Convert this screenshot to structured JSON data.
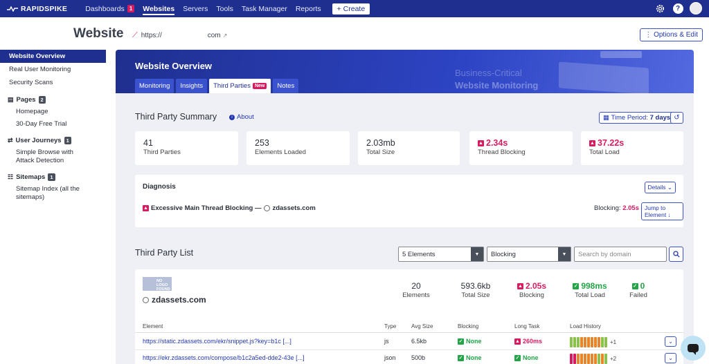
{
  "nav": {
    "logo": "RAPIDSPIKE",
    "items": [
      {
        "label": "Dashboards",
        "badge": "1"
      },
      {
        "label": "Websites"
      },
      {
        "label": "Servers"
      },
      {
        "label": "Tools"
      },
      {
        "label": "Task Manager"
      },
      {
        "label": "Reports"
      }
    ],
    "create": "+ Create",
    "help": "?"
  },
  "header": {
    "title": "Website",
    "url_prefix": "https://",
    "url_suffix": "com",
    "options": "⋮ Options & Edit"
  },
  "sidebar": {
    "overview": "Website Overview",
    "rum": "Real User Monitoring",
    "security": "Security Scans",
    "pages": {
      "label": "Pages",
      "count": "2",
      "items": [
        "Homepage",
        "30-Day Free Trial"
      ]
    },
    "journeys": {
      "label": "User Journeys",
      "count": "1",
      "items": [
        "Simple Browse with Attack Detection"
      ]
    },
    "sitemaps": {
      "label": "Sitemaps",
      "count": "1",
      "items": [
        "Sitemap Index (all the sitemaps)"
      ]
    }
  },
  "banner": {
    "title": "Website Overview",
    "mark1": "Business-Critical",
    "mark2": "Website Monitoring",
    "tabs": [
      "Monitoring",
      "Insights",
      "Third Parties",
      "Notes"
    ],
    "new_badge": "New"
  },
  "summary": {
    "title": "Third Party Summary",
    "about": "About",
    "time_label": "Time Period:",
    "time_value": "7 days",
    "stats": [
      {
        "value": "41",
        "label": "Third Parties"
      },
      {
        "value": "253",
        "label": "Elements Loaded"
      },
      {
        "value": "2.03mb",
        "label": "Total Size"
      },
      {
        "value": "2.34s",
        "label": "Thread Blocking"
      },
      {
        "value": "37.22s",
        "label": "Total Load"
      }
    ]
  },
  "diagnosis": {
    "title": "Diagnosis",
    "details": "Details ⌄",
    "issue": "Excessive Main Thread Blocking —",
    "domain": "zdassets.com",
    "blocking_label": "Blocking:",
    "blocking_value": "2.05s",
    "jump": "Jump to Element ↓"
  },
  "list": {
    "title": "Third Party List",
    "filter1": "5 Elements",
    "filter2": "Blocking",
    "search_placeholder": "Search by domain",
    "no_logo": "NO LOGO FOUND",
    "vendor": "zdassets.com",
    "vendor_stats": [
      {
        "value": "20",
        "label": "Elements"
      },
      {
        "value": "593.6kb",
        "label": "Total Size"
      },
      {
        "value": "2.05s",
        "label": "Blocking"
      },
      {
        "value": "998ms",
        "label": "Total Load"
      },
      {
        "value": "0",
        "label": "Failed"
      }
    ],
    "columns": [
      "Element",
      "Type",
      "Avg Size",
      "Blocking",
      "Long Task",
      "Load History"
    ],
    "rows": [
      {
        "element": "https://static.zdassets.com/ekr/snippet.js?key=b1c [...]",
        "type": "js",
        "size": "6.5kb",
        "blocking": "None",
        "long_task": "260ms",
        "more": "+1"
      },
      {
        "element": "https://ekr.zdassets.com/compose/b1c2a5ed-dde2-43e [...]",
        "type": "json",
        "size": "500b",
        "blocking": "None",
        "long_task": "None",
        "more": "+2"
      }
    ]
  },
  "colors": {
    "nav": "#1f2f8f",
    "accent": "#2338b0",
    "danger": "#d81b60",
    "success": "#22a447",
    "history_row1": [
      "#8bc34a",
      "#8bc34a",
      "#8bc34a",
      "#e8852b",
      "#e8852b",
      "#e8852b",
      "#e8852b",
      "#e8852b",
      "#e8852b",
      "#8bc34a",
      "#8bc34a"
    ],
    "history_row2": [
      "#d81b60",
      "#d81b60",
      "#e8852b",
      "#e8852b",
      "#e8852b",
      "#e8852b",
      "#e8852b",
      "#e8852b",
      "#8bc34a",
      "#e8852b",
      "#8bc34a"
    ]
  }
}
